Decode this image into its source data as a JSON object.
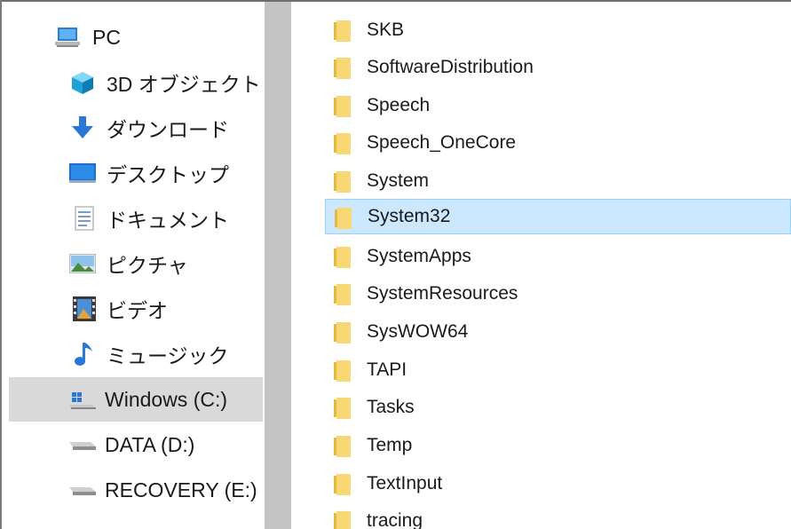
{
  "nav": {
    "items": [
      {
        "label": "PC",
        "icon": "computer-icon"
      },
      {
        "label": "3D オブジェクト",
        "icon": "3d-objects-icon"
      },
      {
        "label": "ダウンロード",
        "icon": "download-arrow-icon"
      },
      {
        "label": "デスクトップ",
        "icon": "desktop-icon"
      },
      {
        "label": "ドキュメント",
        "icon": "document-icon"
      },
      {
        "label": "ピクチャ",
        "icon": "picture-icon"
      },
      {
        "label": "ビデオ",
        "icon": "video-film-icon"
      },
      {
        "label": "ミュージック",
        "icon": "music-note-icon"
      },
      {
        "label": "Windows (C:)",
        "icon": "windows-drive-icon",
        "selected": true
      },
      {
        "label": "DATA (D:)",
        "icon": "drive-icon"
      },
      {
        "label": "RECOVERY (E:)",
        "icon": "drive-icon"
      }
    ]
  },
  "files": {
    "items": [
      {
        "name": "SKB"
      },
      {
        "name": "SoftwareDistribution"
      },
      {
        "name": "Speech"
      },
      {
        "name": "Speech_OneCore"
      },
      {
        "name": "System"
      },
      {
        "name": "System32",
        "selected": true
      },
      {
        "name": "SystemApps"
      },
      {
        "name": "SystemResources"
      },
      {
        "name": "SysWOW64"
      },
      {
        "name": "TAPI"
      },
      {
        "name": "Tasks"
      },
      {
        "name": "Temp"
      },
      {
        "name": "TextInput"
      },
      {
        "name": "tracing"
      }
    ]
  },
  "colors": {
    "selection_bg": "#cce8ff",
    "selection_border": "#99d1ff",
    "nav_selected_bg": "#d9d9d9",
    "folder_yellow": "#f8d775"
  }
}
